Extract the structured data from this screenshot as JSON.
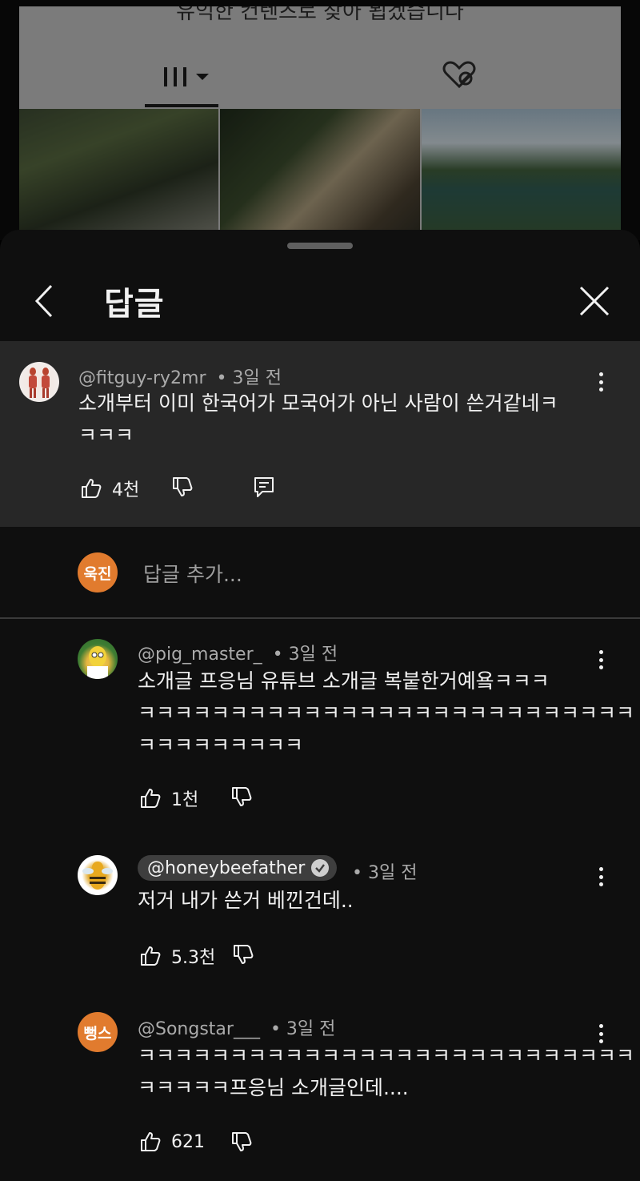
{
  "background": {
    "caption": "유익한 컨텐츠로 찾아 뵙겠습니다"
  },
  "sheet": {
    "title": "답글"
  },
  "parent_comment": {
    "author": "@fitguy-ry2mr",
    "time": "• 3일 전",
    "text_line1": "소개부터 이미 한국어가 모국어가 아닌 사람이 쓴거같네ㅋ",
    "text_line2": "ㅋㅋㅋ",
    "likes": "4천"
  },
  "add_reply": {
    "avatar_text": "욱진",
    "placeholder": "답글 추가..."
  },
  "replies": [
    {
      "author": "@pig_master_",
      "time": "• 3일 전",
      "text_line1": "소개글 프응님 유튜브 소개글 복붙한거예욬ㅋㅋㅋ",
      "text_line2": "ㅋㅋㅋㅋㅋㅋㅋㅋㅋㅋㅋㅋㅋㅋㅋㅋㅋㅋㅋㅋㅋㅋㅋㅋㅋㅋㅋ",
      "text_line3": "ㅋㅋㅋㅋㅋㅋㅋㅋㅋ",
      "likes": "1천"
    },
    {
      "author": "@honeybeefather",
      "time": "• 3일 전",
      "text_line1": "저거 내가 쓴거 베낀건데..",
      "likes": "5.3천"
    },
    {
      "author": "@Songstar___",
      "avatar_text": "뻥스",
      "time": "• 3일 전",
      "text_line1": "ㅋㅋㅋㅋㅋㅋㅋㅋㅋㅋㅋㅋㅋㅋㅋㅋㅋㅋㅋㅋㅋㅋㅋㅋㅋㅋㅋ",
      "text_line2": "ㅋㅋㅋㅋㅋ프응님 소개글인데....",
      "likes": "621"
    }
  ],
  "icons": {
    "back": "chevron-left-icon",
    "close": "close-icon",
    "like": "thumbs-up-icon",
    "dislike": "thumbs-down-icon",
    "reply": "reply-icon",
    "more": "more-vert-icon",
    "verified": "verified-check-icon"
  },
  "colors": {
    "sheet_bg": "#0f0f0f",
    "highlight_bg": "#272727",
    "self_avatar": "#e17b2e",
    "meta_text": "#aaaaaa"
  }
}
